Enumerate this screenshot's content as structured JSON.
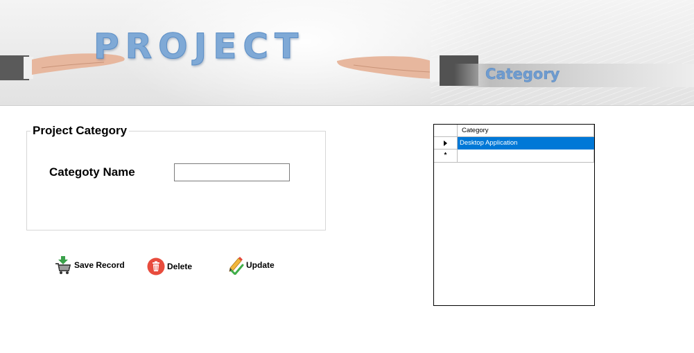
{
  "banner": {
    "title": "PROJECT",
    "subtitle": "Category",
    "title_color": "#7fa9d6"
  },
  "form": {
    "group_title": "Project Category",
    "field_label": "Categoty Name",
    "field_value": "",
    "field_placeholder": ""
  },
  "actions": {
    "save_label": "Save Record",
    "delete_label": "Delete",
    "update_label": "Update",
    "save_icon": "cart-add-icon",
    "delete_icon": "trash-icon",
    "update_icon": "pencil-check-icon"
  },
  "grid": {
    "column_header": "Category",
    "rows": [
      {
        "category": "Desktop Application",
        "selected": true,
        "indicator": "current-row-arrow"
      },
      {
        "category": "",
        "selected": false,
        "indicator": "new-row-star"
      }
    ],
    "selection_color": "#0078d7"
  }
}
